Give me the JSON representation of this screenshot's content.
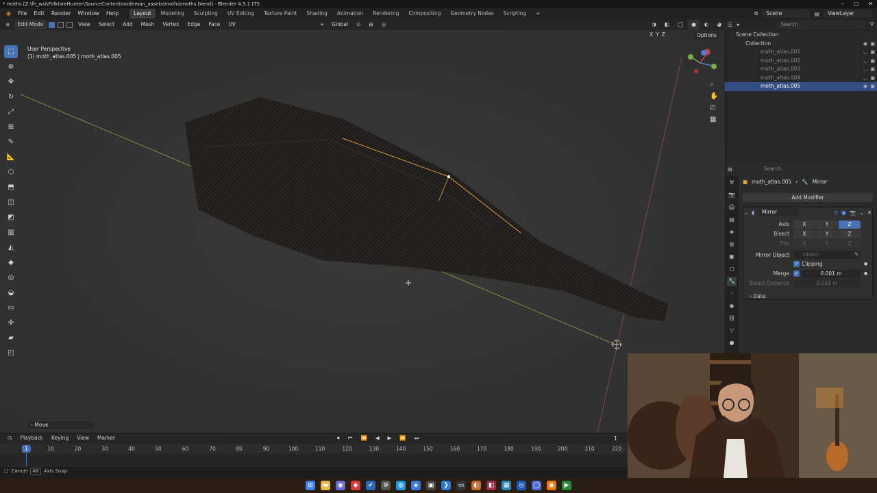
{
  "window": {
    "title": "* moths [Z:\\fh_wsi\\FolkloreHunter\\SourceContent\\mothman_assets\\moths\\moths.blend] - Blender 4.5.1 LTS"
  },
  "menu": [
    "File",
    "Edit",
    "Render",
    "Window",
    "Help"
  ],
  "workspaces": [
    "Layout",
    "Modeling",
    "Sculpting",
    "UV Editing",
    "Texture Paint",
    "Shading",
    "Animation",
    "Rendering",
    "Compositing",
    "Geometry Nodes",
    "Scripting"
  ],
  "active_workspace": "Layout",
  "scene": {
    "name": "Scene",
    "view_layer": "ViewLayer",
    "search_placeholder": "Search"
  },
  "viewport_header": {
    "mode": "Edit Mode",
    "items": [
      "View",
      "Select",
      "Add",
      "Mesh",
      "Vertex",
      "Edge",
      "Face",
      "UV"
    ],
    "transform": "Global",
    "options": "Options",
    "axes": [
      "X",
      "Y",
      "Z"
    ]
  },
  "viewport": {
    "perspective": "User Perspective",
    "object_info": "(1) moth_atlas.005 | moth_atlas.005",
    "last_op": "Move"
  },
  "outliner": {
    "root": "Scene Collection",
    "collection": "Collection",
    "objects": [
      "moth_atlas.001",
      "moth_atlas.002",
      "moth_atlas.003",
      "moth_atlas.004",
      "moth_atlas.005"
    ],
    "selected": "moth_atlas.005"
  },
  "properties": {
    "search_placeholder": "Search",
    "breadcrumb_object": "moth_atlas.005",
    "breadcrumb_modifier": "Mirror",
    "add_modifier": "Add Modifier",
    "modifier_name": "Mirror",
    "axis_label": "Axis",
    "bisect_label": "Bisect",
    "flip_label": "Flip",
    "axis_buttons": [
      "X",
      "Y",
      "Z"
    ],
    "axis_on": "Z",
    "mirror_object_label": "Mirror Object",
    "mirror_object_placeholder": "Object",
    "clipping_label": "Clipping",
    "merge_label": "Merge",
    "merge_value": "0.001 m",
    "bisect_distance_label": "Bisect Distance",
    "bisect_distance_value": "0.001 m",
    "data_panel": "Data"
  },
  "timeline": {
    "menu": [
      "Playback",
      "Keying",
      "View",
      "Marker"
    ],
    "current_frame": "1",
    "frame_display": "1",
    "ruler": [
      "10",
      "20",
      "30",
      "40",
      "50",
      "60",
      "70",
      "80",
      "90",
      "100",
      "110",
      "120",
      "130",
      "140",
      "150",
      "160",
      "170",
      "180",
      "190",
      "200",
      "210",
      "220"
    ]
  },
  "statusbar": {
    "cancel": "Cancel",
    "alt_key": "Alt",
    "axis_snap": "Axis Snap"
  }
}
